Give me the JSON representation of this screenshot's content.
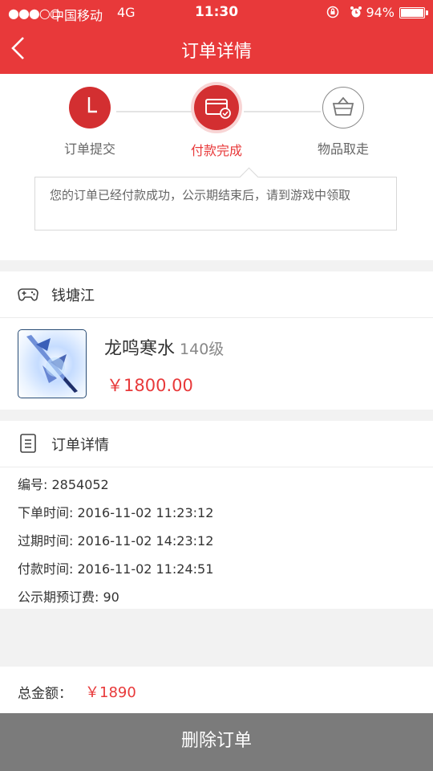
{
  "status": {
    "signal": "●●●○○",
    "carrier": "中国移动",
    "network": "4G",
    "time": "11:30",
    "battery_percent": "94%",
    "battery_level": 0.94
  },
  "nav": {
    "title": "订单详情"
  },
  "steps": [
    {
      "label": "订单提交",
      "state": "done"
    },
    {
      "label": "付款完成",
      "state": "active"
    },
    {
      "label": "物品取走",
      "state": "pending"
    }
  ],
  "notice": {
    "text": "您的订单已经付款成功，公示期结束后，请到游戏中领取"
  },
  "item_section": {
    "server_name": "钱塘江",
    "item_name": "龙鸣寒水",
    "item_level": "140级",
    "item_price": "￥1800.00"
  },
  "detail_section": {
    "title": "订单详情",
    "rows": [
      "编号: 2854052",
      "下单时间: 2016-11-02 11:23:12",
      "过期时间: 2016-11-02 14:23:12",
      "付款时间: 2016-11-02 11:24:51",
      "公示期预订费: 90"
    ]
  },
  "total": {
    "label": "总金额：",
    "value": "￥1890"
  },
  "actions": {
    "delete_label": "删除订单"
  },
  "colors": {
    "brand": "#e8393a",
    "button_gray": "#7b7b7b"
  }
}
